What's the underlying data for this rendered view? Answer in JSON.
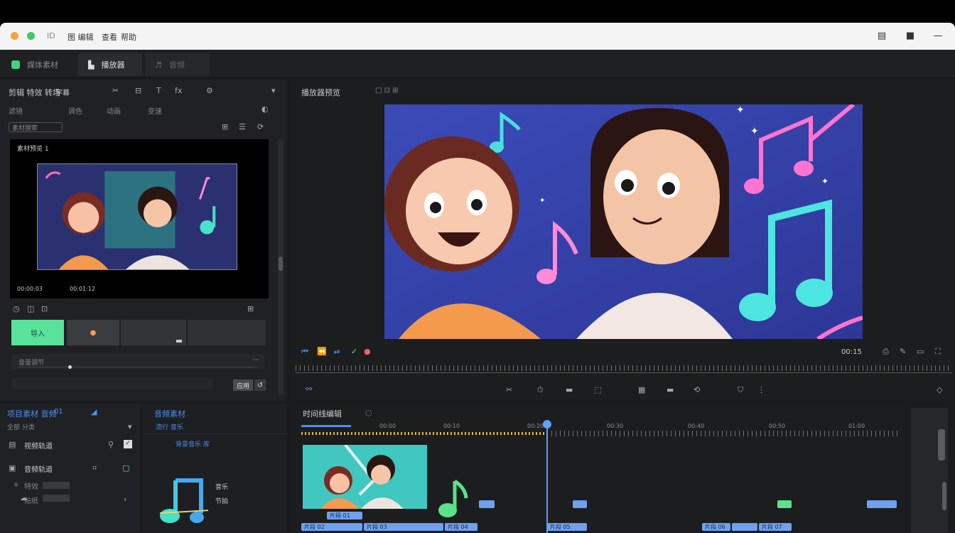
{
  "titlebar": {
    "app_icon": "ID",
    "menu": [
      "图 编辑",
      "查看",
      "帮助"
    ],
    "controls": [
      "minimize-icon",
      "maximize-icon",
      "close-icon"
    ],
    "traffic_colors": [
      "#f5a33b",
      "#42c95e"
    ]
  },
  "tabs": [
    {
      "label": "媒体素材",
      "icon": "media-icon",
      "active": false
    },
    {
      "label": "播放器",
      "icon": "player-icon",
      "active": true
    },
    {
      "label": "音频",
      "icon": "audio-icon",
      "active": false
    }
  ],
  "left_panel": {
    "header": "剪辑 特效 转场",
    "header_sub": "字幕",
    "row2": [
      "滤镜",
      "调色",
      "动画",
      "变速"
    ],
    "search_label": "素材搜索",
    "preview_caption": "素材预览 1",
    "preview_time": "00:00:03",
    "preview_time_right": "00:01:12",
    "buttons": [
      "导入",
      "●",
      "",
      ""
    ],
    "slider_label": "音量调节",
    "apply_label": "应用"
  },
  "viewer": {
    "title": "播放器预览",
    "title_icons": "□ ⊡ ⊞",
    "playback_time": "00:15",
    "scene_alt": "cartoon two girls music notes"
  },
  "toolbar_icons": [
    "split-icon",
    "speed-icon",
    "crop-icon",
    "mask-icon",
    "freeze-icon",
    "mirror-icon",
    "rotate-icon",
    "shield-icon",
    "more-icon"
  ],
  "bottom_left": {
    "title": "项目素材 音频",
    "title_badge": "01",
    "filter": "全部 分类",
    "items": [
      {
        "label": "视频轨道",
        "icon": "video-track-icon"
      },
      {
        "label": "音频轨道",
        "icon": "audio-track-icon"
      },
      {
        "label": "特效",
        "icon": "fx-icon"
      },
      {
        "label": "贴纸",
        "icon": "sticker-icon"
      }
    ]
  },
  "bottom_mid": {
    "title": "音频素材",
    "subtitle": "流行 音乐",
    "sub2": "背景音乐 库",
    "music_label_1": "音乐",
    "music_label_2": "节拍"
  },
  "timeline": {
    "title": "时间线编辑",
    "ticks": [
      "00:00",
      "00:10",
      "00:20",
      "00:30",
      "00:40",
      "00:50",
      "01:00",
      "01:10"
    ],
    "clip_labels": [
      "片段 01",
      "片段 02",
      "片段 03",
      "片段 04",
      "片段 05",
      "片段 06",
      "片段 07"
    ]
  },
  "colors": {
    "accent_green": "#58e29a",
    "accent_blue": "#4b8ff0",
    "playhead": "#5aa0ff",
    "scene_bg": "#3a4ab0"
  }
}
